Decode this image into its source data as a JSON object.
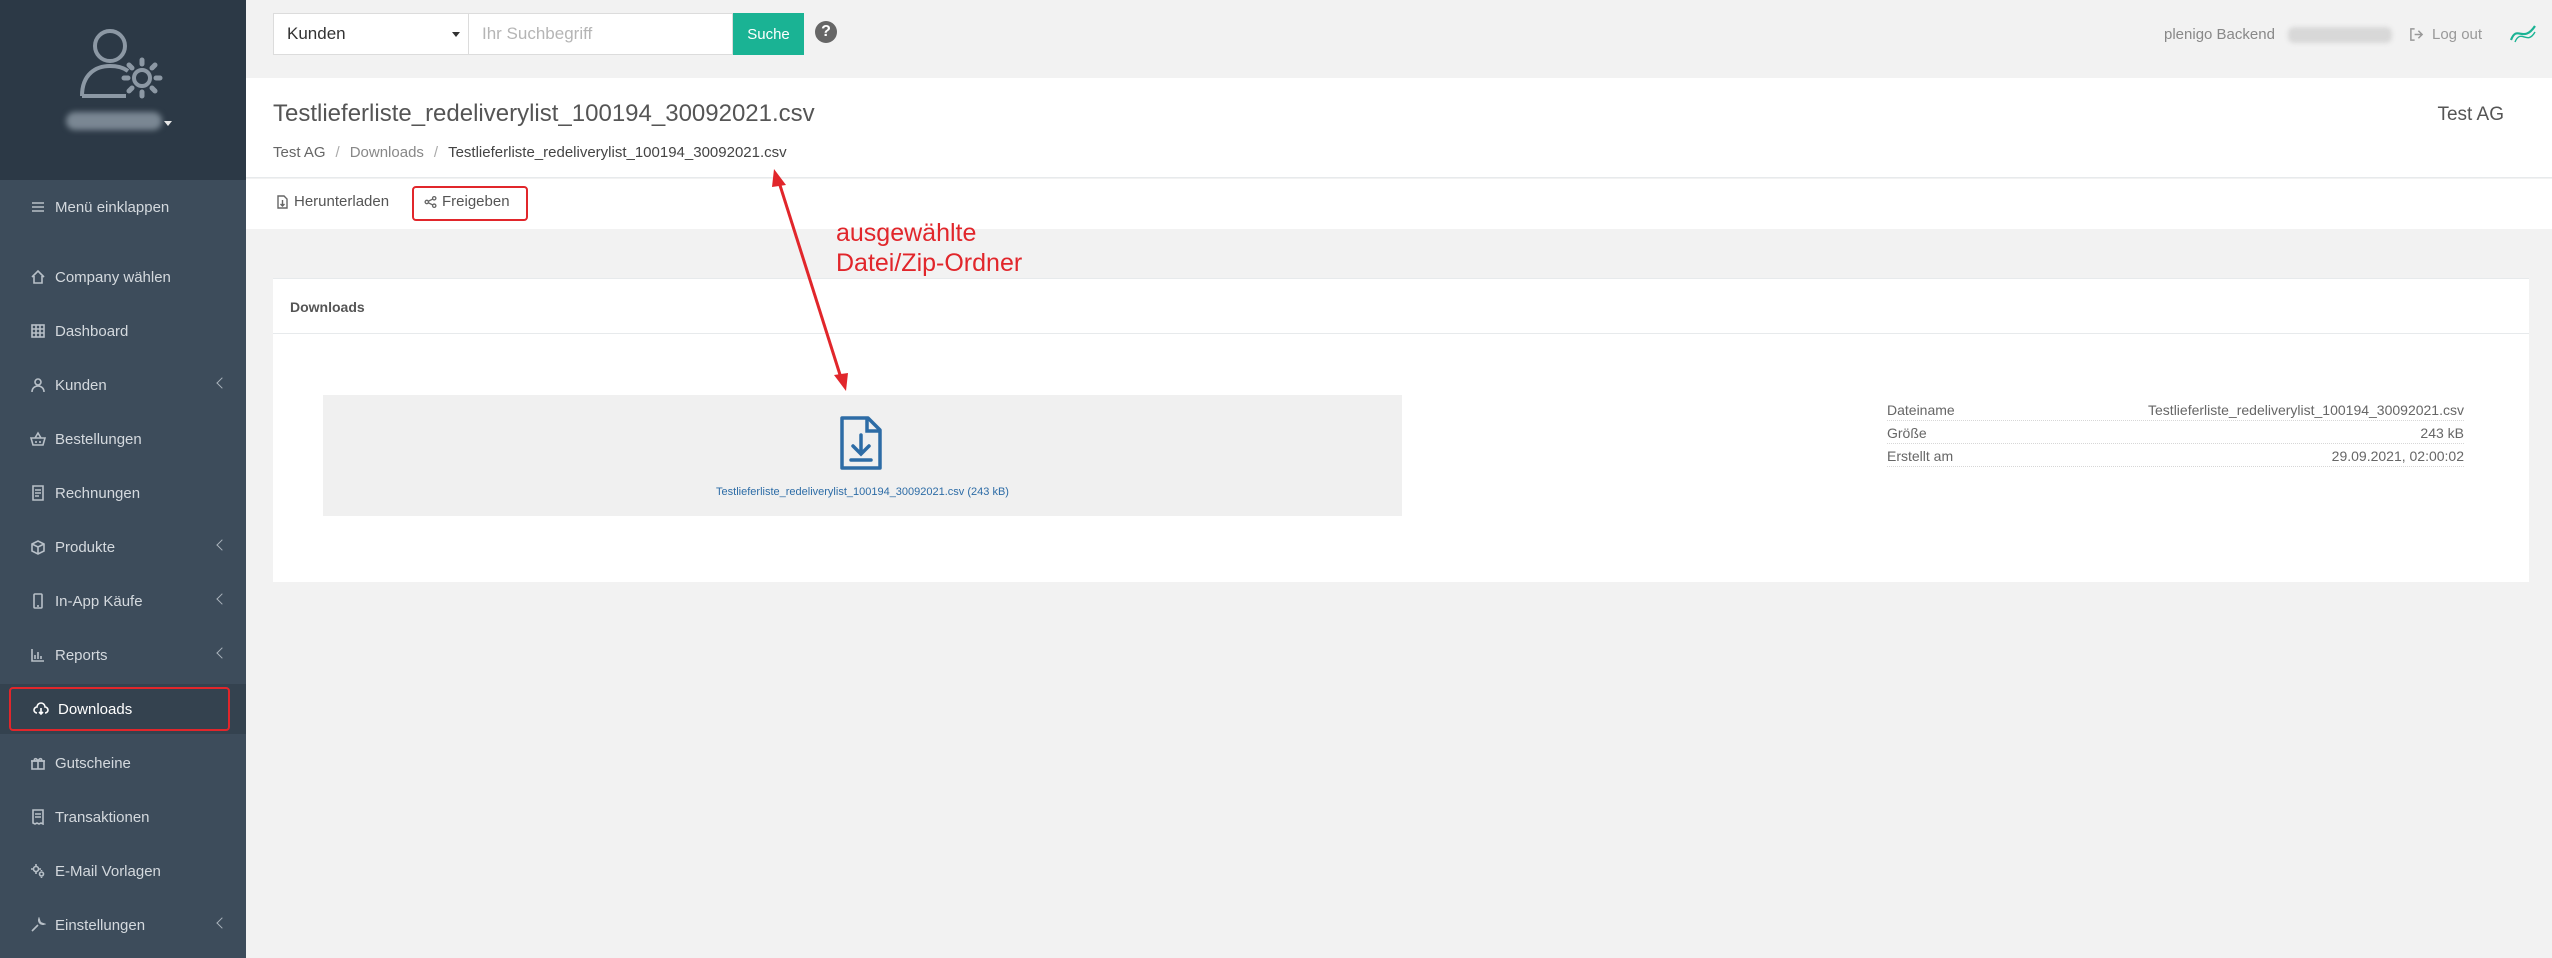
{
  "sidebar": {
    "items": [
      {
        "label": "Menü einklappen",
        "icon": "hamburger-icon"
      },
      {
        "label": "Company wählen",
        "icon": "home-icon"
      },
      {
        "label": "Dashboard",
        "icon": "grid-icon"
      },
      {
        "label": "Kunden",
        "icon": "user-icon"
      },
      {
        "label": "Bestellungen",
        "icon": "basket-icon"
      },
      {
        "label": "Rechnungen",
        "icon": "invoice-icon"
      },
      {
        "label": "Produkte",
        "icon": "box-icon"
      },
      {
        "label": "In-App Käufe",
        "icon": "mobile-icon"
      },
      {
        "label": "Reports",
        "icon": "chart-icon"
      },
      {
        "label": "Downloads",
        "icon": "cloud-download-icon"
      },
      {
        "label": "Gutscheine",
        "icon": "gift-icon"
      },
      {
        "label": "Transaktionen",
        "icon": "receipt-icon"
      },
      {
        "label": "E-Mail Vorlagen",
        "icon": "gears-icon"
      },
      {
        "label": "Einstellungen",
        "icon": "wrench-icon"
      }
    ]
  },
  "topbar": {
    "select_value": "Kunden",
    "search_placeholder": "Ihr Suchbegriff",
    "search_button": "Suche",
    "help_glyph": "?",
    "backend_label": "plenigo Backend",
    "logout_label": "Log out"
  },
  "heading": {
    "title": "Testlieferliste_redeliverylist_100194_30092021.csv",
    "breadcrumb": [
      "Test AG",
      "Downloads",
      "Testlieferliste_redeliverylist_100194_30092021.csv"
    ],
    "breadcrumb_separator": "/",
    "company": "Test AG"
  },
  "actions": {
    "download": "Herunterladen",
    "share": "Freigeben"
  },
  "panel": {
    "title": "Downloads",
    "file_link": "Testlieferliste_redeliverylist_100194_30092021.csv (243 kB)",
    "meta": [
      {
        "key": "Dateiname",
        "value": "Testlieferliste_redeliverylist_100194_30092021.csv"
      },
      {
        "key": "Größe",
        "value": "243 kB"
      },
      {
        "key": "Erstellt am",
        "value": "29.09.2021, 02:00:02"
      }
    ]
  },
  "annotation": {
    "line1": "ausgewählte",
    "line2": "Datei/Zip-Ordner",
    "color": "#e1262b"
  },
  "colors": {
    "sidebar_bg": "#3d4c5b",
    "sidebar_top_bg": "#2c3946",
    "accent_green": "#1ab394",
    "highlight_red": "#e1262b",
    "link_blue": "#2d6ca6"
  }
}
